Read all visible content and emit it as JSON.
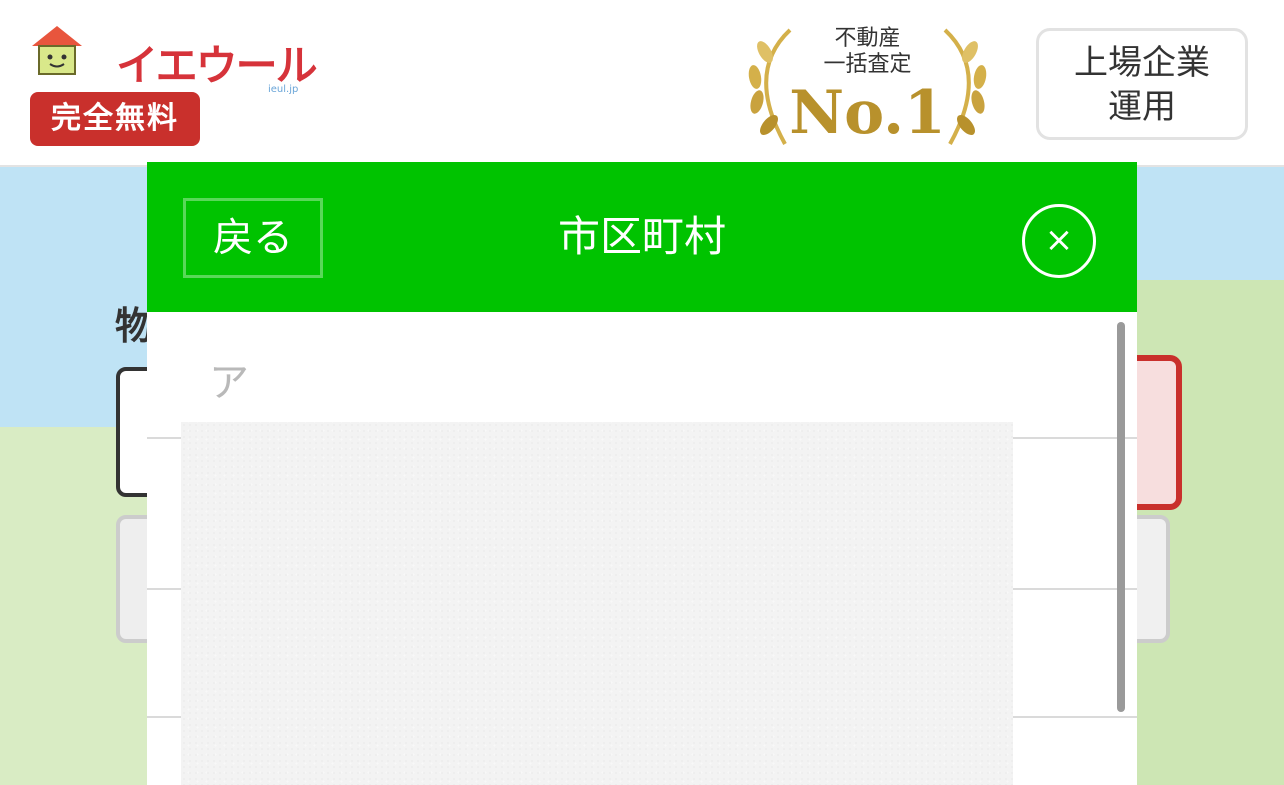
{
  "header": {
    "logo_text": "イエウール",
    "logo_sub": "ieul.jp",
    "free_badge": "完全無料",
    "award_line1": "不動産",
    "award_line2": "一括査定",
    "award_main": "No.1",
    "listed_line1": "上場企業",
    "listed_line2": "運用"
  },
  "background": {
    "title_fragment": "物",
    "field_fragment": ""
  },
  "modal": {
    "back_label": "戻る",
    "title": "市区町村",
    "close_symbol": "×",
    "section_label": "ア"
  },
  "colors": {
    "accent_green": "#00c300",
    "brand_red": "#c9302c",
    "award_gold": "#b8912c"
  }
}
